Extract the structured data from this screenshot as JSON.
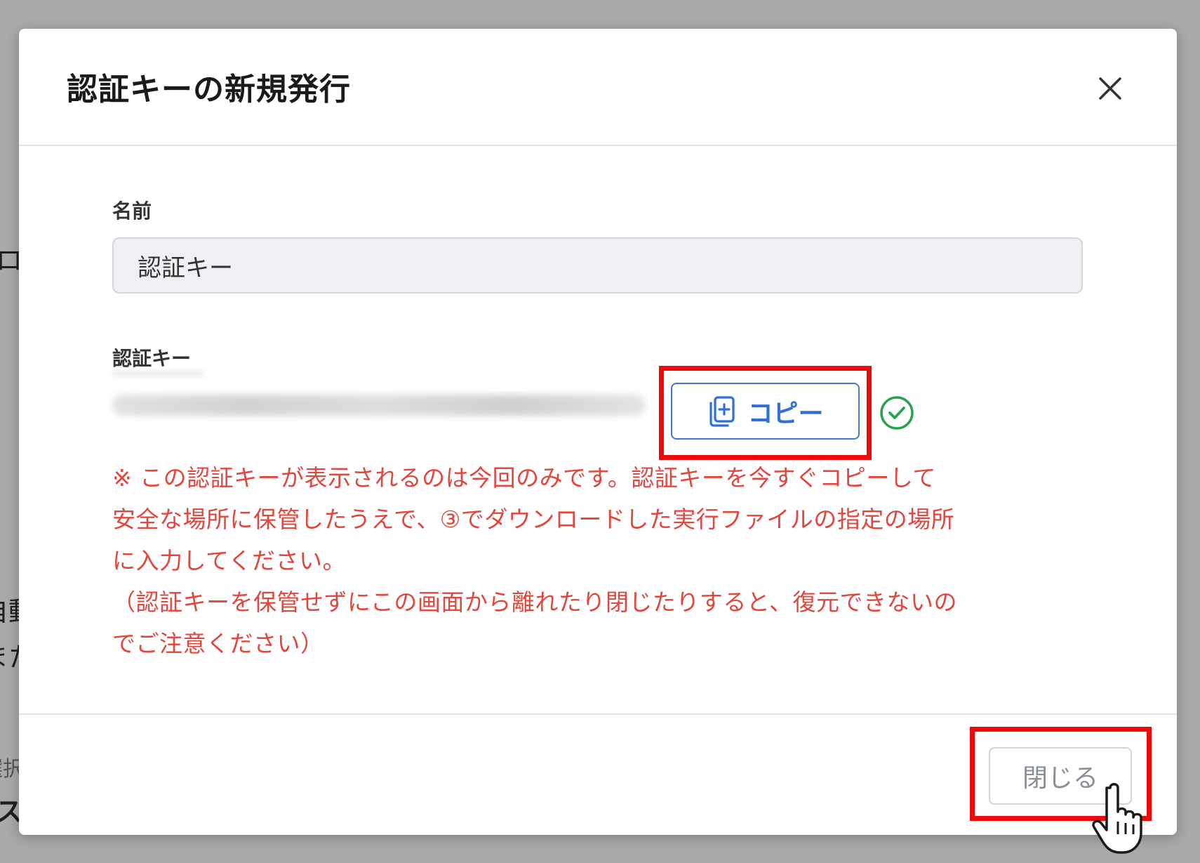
{
  "background": {
    "fragments": [
      "ロ",
      "自動",
      "また",
      "選択",
      "ス"
    ]
  },
  "dialog": {
    "title": "認証キーの新規発行",
    "close_icon": "close-icon"
  },
  "form": {
    "name_label": "名前",
    "name_value": "認証キー",
    "key_label": "認証キー",
    "copy_button_label": "コピー",
    "copy_icon": "copy-document-icon",
    "copied_status_icon": "check-circle-icon",
    "warning_lines": [
      "※ この認証キーが表示されるのは今回のみです。認証キーを今すぐコピーして",
      "安全な場所に保管したうえで、③でダウンロードした実行ファイルの指定の場所",
      "に入力してください。",
      "（認証キーを保管せずにこの画面から離れたり閉じたりすると、復元できないの",
      "でご注意ください）"
    ]
  },
  "footer": {
    "close_button_label": "閉じる"
  },
  "colors": {
    "accent_blue": "#2f6fd6",
    "warning_red": "#e2463c",
    "success_green": "#2aa24a",
    "highlight_red": "#ee0a0a",
    "overlay_gray": "#a8a9ab"
  }
}
